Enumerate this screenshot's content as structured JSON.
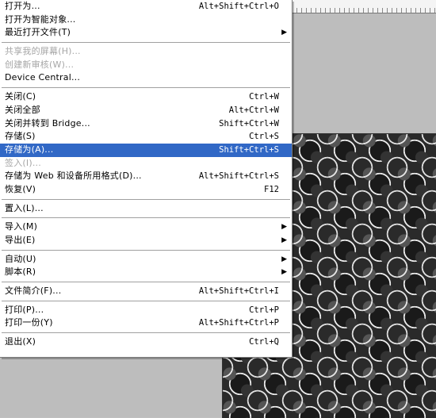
{
  "menu": {
    "items": [
      {
        "label": "打开为...",
        "shortcut": "Alt+Shift+Ctrl+O"
      },
      {
        "label": "打开为智能对象...",
        "shortcut": ""
      },
      {
        "label": "最近打开文件(T)",
        "shortcut": "",
        "submenu": "▶"
      },
      {
        "label": "共享我的屏幕(H)...",
        "shortcut": ""
      },
      {
        "label": "创建新审核(W)...",
        "shortcut": ""
      },
      {
        "label": "Device Central...",
        "shortcut": ""
      },
      {
        "label": "关闭(C)",
        "shortcut": "Ctrl+W"
      },
      {
        "label": "关闭全部",
        "shortcut": "Alt+Ctrl+W"
      },
      {
        "label": "关闭并转到 Bridge...",
        "shortcut": "Shift+Ctrl+W"
      },
      {
        "label": "存储(S)",
        "shortcut": "Ctrl+S"
      },
      {
        "label": "存储为(A)...",
        "shortcut": "Shift+Ctrl+S"
      },
      {
        "label": "签入(I)...",
        "shortcut": ""
      },
      {
        "label": "存储为 Web 和设备所用格式(D)...",
        "shortcut": "Alt+Shift+Ctrl+S"
      },
      {
        "label": "恢复(V)",
        "shortcut": "F12"
      },
      {
        "label": "置入(L)...",
        "shortcut": ""
      },
      {
        "label": "导入(M)",
        "shortcut": "",
        "submenu": "▶"
      },
      {
        "label": "导出(E)",
        "shortcut": "",
        "submenu": "▶"
      },
      {
        "label": "自动(U)",
        "shortcut": "",
        "submenu": "▶"
      },
      {
        "label": "脚本(R)",
        "shortcut": "",
        "submenu": "▶"
      },
      {
        "label": "文件简介(F)...",
        "shortcut": "Alt+Shift+Ctrl+I"
      },
      {
        "label": "打印(P)...",
        "shortcut": "Ctrl+P"
      },
      {
        "label": "打印一份(Y)",
        "shortcut": "Alt+Shift+Ctrl+P"
      },
      {
        "label": "退出(X)",
        "shortcut": "Ctrl+Q"
      }
    ]
  },
  "colors": {
    "highlight": "#3168c6",
    "disabled_text": "#a6a6a6"
  }
}
